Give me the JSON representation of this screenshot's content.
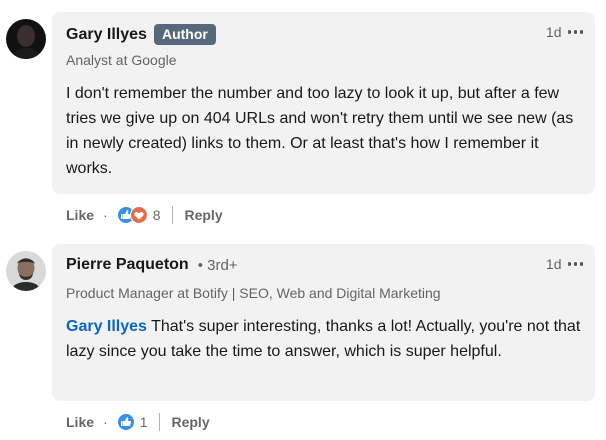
{
  "comments": [
    {
      "author": "Gary Illyes",
      "badge": "Author",
      "headline": "Analyst at Google",
      "time": "1d",
      "text": "I don't remember the number and too lazy to look it up, but after a few tries we give up on 404 URLs and won't retry them until we see new (as in newly created) links to them. Or at least that's how I remember it works.",
      "like_label": "Like",
      "reaction_count": "8",
      "reactions": [
        "like-icon",
        "love-icon"
      ],
      "reply_label": "Reply"
    },
    {
      "author": "Pierre Paqueton",
      "degree": "• 3rd+",
      "headline": "Product Manager at Botify | SEO, Web and Digital Marketing",
      "time": "1d",
      "mention": "Gary Illyes",
      "text": " That's super interesting, thanks a lot! Actually, you're not that lazy since you take the time to answer, which is super helpful.",
      "like_label": "Like",
      "reaction_count": "1",
      "reactions": [
        "like-icon"
      ],
      "reply_label": "Reply"
    }
  ],
  "colors": {
    "bubble": "#f2f2f2",
    "badge": "#56687a",
    "mention": "#0a66c2",
    "like": "#378fe9",
    "love": "#df704d"
  }
}
